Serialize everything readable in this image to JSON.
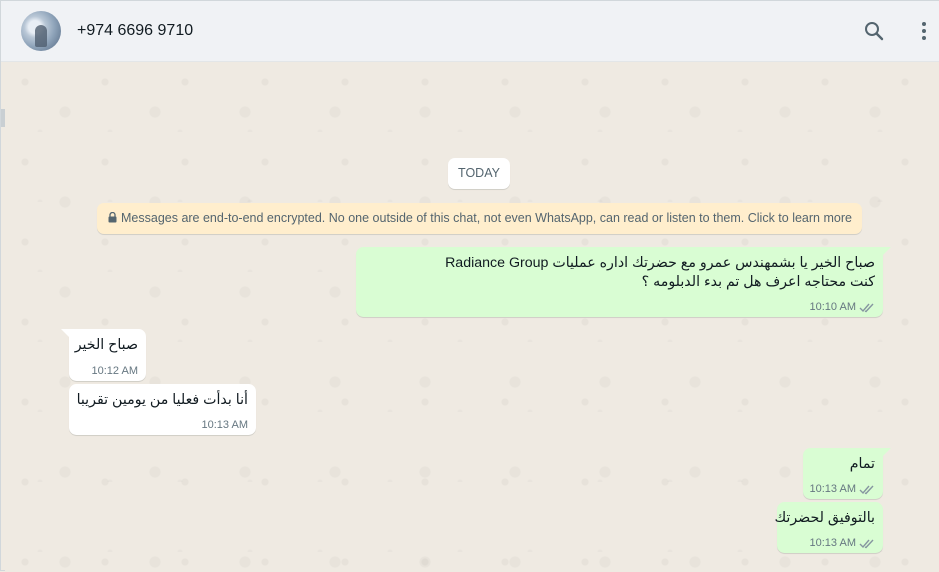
{
  "header": {
    "contact_name": "+974 6696 9710",
    "icons": [
      "search-icon",
      "menu-icon"
    ]
  },
  "chat": {
    "date_chip": "TODAY",
    "encryption_notice": "Messages are end-to-end encrypted. No one outside of this chat, not even WhatsApp, can read or listen to them. Click to learn more",
    "messages": [
      {
        "direction": "outgoing",
        "lines": [
          "صباح الخير يا بشمهندس عمرو مع حضرتك اداره عمليات Radiance Group",
          "كنت محتاجه اعرف هل تم بدء الدبلومه ؟"
        ],
        "time": "10:10 AM",
        "status": "read"
      },
      {
        "direction": "incoming",
        "lines": [
          "صباح الخير"
        ],
        "time": "10:12 AM"
      },
      {
        "direction": "incoming",
        "lines": [
          "أنا بدأت فعليا من يومين تقريبا"
        ],
        "time": "10:13 AM"
      },
      {
        "direction": "outgoing",
        "lines": [
          "تمام"
        ],
        "time": "10:13 AM",
        "status": "read"
      },
      {
        "direction": "outgoing",
        "lines": [
          "بالتوفيق لحضرتك"
        ],
        "time": "10:13 AM",
        "status": "read"
      }
    ]
  },
  "colors": {
    "outgoing_bubble": "#d9fdd3",
    "incoming_bubble": "#ffffff",
    "encryption_bg": "#ffeecd",
    "chat_bg": "#efeae2",
    "read_tick": "#8696a0"
  }
}
